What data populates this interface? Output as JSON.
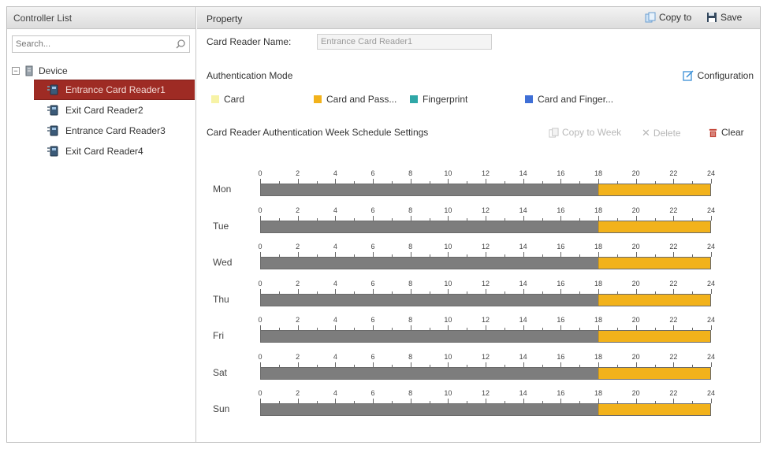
{
  "left_panel": {
    "title": "Controller List",
    "search_placeholder": "Search...",
    "tree": {
      "root_label": "Device",
      "items": [
        {
          "label": "Entrance Card Reader1",
          "selected": true
        },
        {
          "label": "Exit Card Reader2",
          "selected": false
        },
        {
          "label": "Entrance Card Reader3",
          "selected": false
        },
        {
          "label": "Exit Card Reader4",
          "selected": false
        }
      ]
    }
  },
  "right_panel": {
    "title": "Property",
    "copy_to_label": "Copy to",
    "save_label": "Save",
    "card_reader_name_label": "Card Reader Name:",
    "card_reader_name_value": "Entrance Card Reader1",
    "auth_mode_title": "Authentication Mode",
    "configuration_label": "Configuration",
    "legend": [
      {
        "label": "Card",
        "color": "#f7f3a6"
      },
      {
        "label": "Card and Pass...",
        "color": "#f2b21b"
      },
      {
        "label": "Fingerprint",
        "color": "#2fa7a7"
      },
      {
        "label": "Card and Finger...",
        "color": "#3f6fd6"
      }
    ],
    "schedule_title": "Card Reader Authentication Week Schedule Settings",
    "copy_to_week_label": "Copy to Week",
    "delete_label": "Delete",
    "clear_label": "Clear"
  },
  "schedule": {
    "tick_labels": [
      "0",
      "2",
      "4",
      "6",
      "8",
      "10",
      "12",
      "14",
      "16",
      "18",
      "20",
      "22",
      "24"
    ],
    "hours_max": 24,
    "days": [
      {
        "label": "Mon",
        "segments": [
          {
            "start": 18,
            "end": 24,
            "mode": "Card and Pass..."
          }
        ]
      },
      {
        "label": "Tue",
        "segments": [
          {
            "start": 18,
            "end": 24,
            "mode": "Card and Pass..."
          }
        ]
      },
      {
        "label": "Wed",
        "segments": [
          {
            "start": 18,
            "end": 24,
            "mode": "Card and Pass..."
          }
        ]
      },
      {
        "label": "Thu",
        "segments": [
          {
            "start": 18,
            "end": 24,
            "mode": "Card and Pass..."
          }
        ]
      },
      {
        "label": "Fri",
        "segments": [
          {
            "start": 18,
            "end": 24,
            "mode": "Card and Pass..."
          }
        ]
      },
      {
        "label": "Sat",
        "segments": [
          {
            "start": 18,
            "end": 24,
            "mode": "Card and Pass..."
          }
        ]
      },
      {
        "label": "Sun",
        "segments": [
          {
            "start": 18,
            "end": 24,
            "mode": "Card and Pass..."
          }
        ]
      }
    ]
  },
  "colors": {
    "selected_row": "#9e2b24",
    "bar_base": "#7d7d7d",
    "bar_segment": "#f2b21b",
    "clear_icon": "#c0392b",
    "config_icon": "#3a8fd6"
  },
  "icons": {
    "search": "search-icon",
    "copy_to": "copy-icon",
    "save": "floppy-disk-icon",
    "configuration": "edit-icon",
    "copy_to_week": "copy-icon",
    "delete": "close-icon",
    "clear": "trash-icon"
  }
}
